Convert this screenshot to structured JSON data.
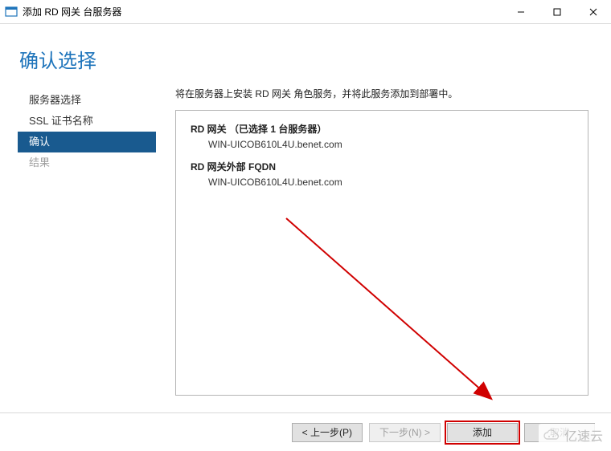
{
  "window": {
    "title": "添加 RD 网关 台服务器",
    "min_icon": "minimize-icon",
    "max_icon": "maximize-icon",
    "close_icon": "close-icon"
  },
  "header": "确认选择",
  "sidebar": {
    "items": [
      {
        "label": "服务器选择",
        "state": "visited"
      },
      {
        "label": "SSL 证书名称",
        "state": "visited"
      },
      {
        "label": "确认",
        "state": "active"
      },
      {
        "label": "结果",
        "state": "dim"
      }
    ]
  },
  "content": {
    "intro": "将在服务器上安装 RD 网关 角色服务，并将此服务添加到部署中。",
    "sections": [
      {
        "title": "RD 网关 （已选择 1 台服务器）",
        "value": "WIN-UICOB610L4U.benet.com"
      },
      {
        "title": "RD 网关外部 FQDN",
        "value": "WIN-UICOB610L4U.benet.com"
      }
    ]
  },
  "buttons": {
    "prev": "< 上一步(P)",
    "next": "下一步(N) >",
    "add": "添加",
    "cancel": "取消"
  },
  "watermark": {
    "text": "亿速云"
  }
}
